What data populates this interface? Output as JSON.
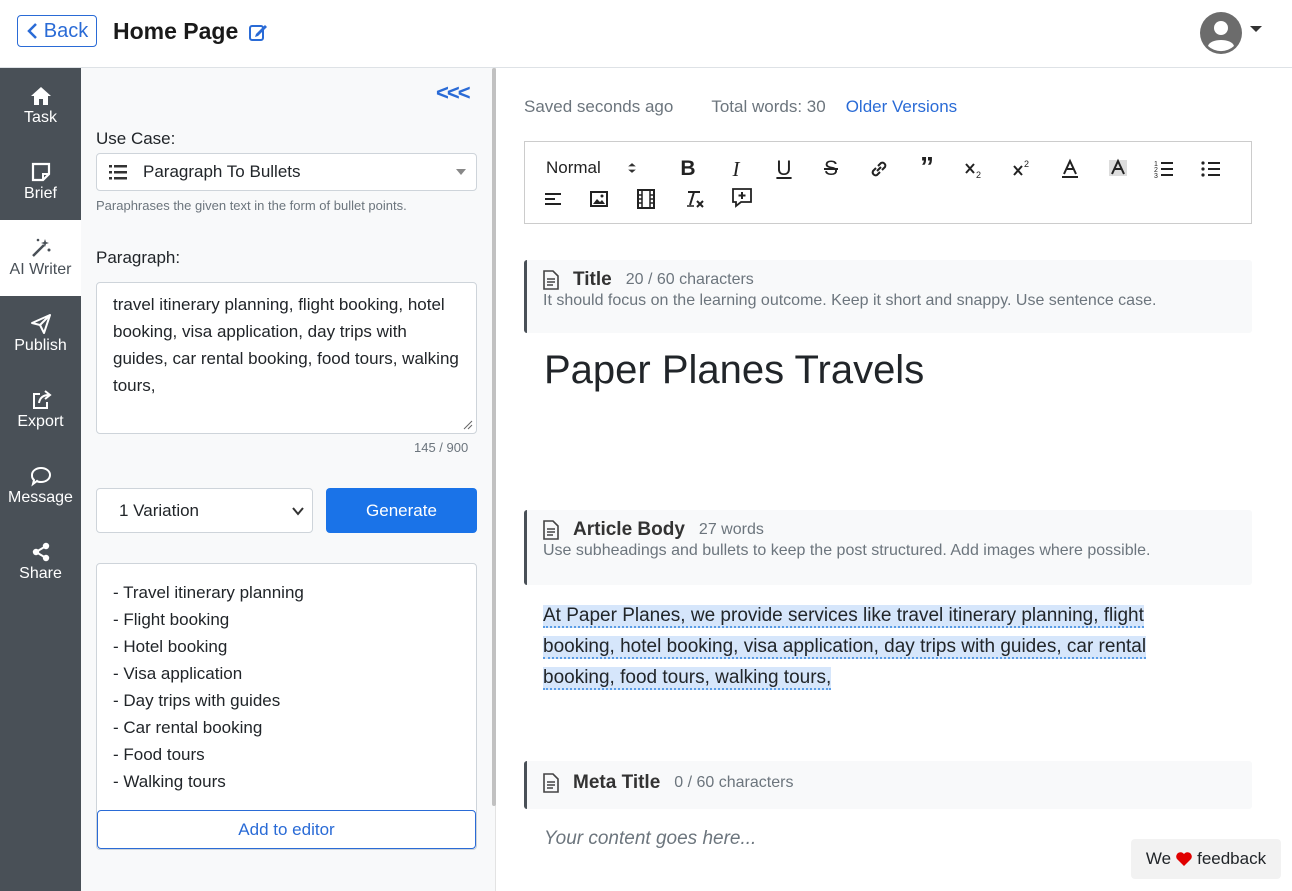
{
  "header": {
    "back_label": "Back",
    "page_title": "Home Page"
  },
  "sidebar": {
    "items": [
      {
        "label": "Task",
        "icon": "home-icon"
      },
      {
        "label": "Brief",
        "icon": "note-icon"
      },
      {
        "label": "AI Writer",
        "icon": "magic-wand-icon",
        "active": true
      },
      {
        "label": "Publish",
        "icon": "send-icon"
      },
      {
        "label": "Export",
        "icon": "export-icon"
      },
      {
        "label": "Message",
        "icon": "chat-icon"
      },
      {
        "label": "Share",
        "icon": "share-icon"
      }
    ]
  },
  "panel": {
    "collapse_label": "<<<",
    "use_case_label": "Use Case:",
    "use_case_value": "Paragraph To Bullets",
    "use_case_hint": "Paraphrases the given text in the form of bullet points.",
    "paragraph_label": "Paragraph:",
    "paragraph_value": "travel itinerary planning, flight booking, hotel booking, visa application, day trips with guides, car rental booking, food tours, walking tours,",
    "char_count": "145 / 900",
    "variation_value": "1 Variation",
    "generate_label": "Generate",
    "results": [
      "- Travel itinerary planning",
      "- Flight booking",
      "- Hotel booking",
      "- Visa application",
      "- Day trips with guides",
      "- Car rental booking",
      "- Food tours",
      "- Walking tours"
    ],
    "add_label": "Add to editor"
  },
  "editor": {
    "saved_status": "Saved seconds ago",
    "total_words": "Total words: 30",
    "older_versions": "Older Versions",
    "toolbar": {
      "format_value": "Normal"
    },
    "sections": {
      "title": {
        "name": "Title",
        "meta": "20 / 60 characters",
        "hint": "It should focus on the learning outcome. Keep it short and snappy. Use sentence case.",
        "content": "Paper Planes Travels"
      },
      "body": {
        "name": "Article Body",
        "meta": "27 words",
        "hint": "Use subheadings and bullets to keep the post structured. Add images where possible.",
        "content": "At Paper Planes, we provide services like travel itinerary planning, flight booking, hotel booking, visa application, day trips with guides, car rental booking, food tours, walking tours,"
      },
      "meta_title": {
        "name": "Meta Title",
        "meta": "0 / 60 characters",
        "placeholder": "Your content goes here..."
      }
    }
  },
  "feedback": {
    "before": "We",
    "after": "feedback",
    "heart_color": "#e00000"
  },
  "colors": {
    "accent": "#1a73e8",
    "sidebar": "#495057"
  }
}
